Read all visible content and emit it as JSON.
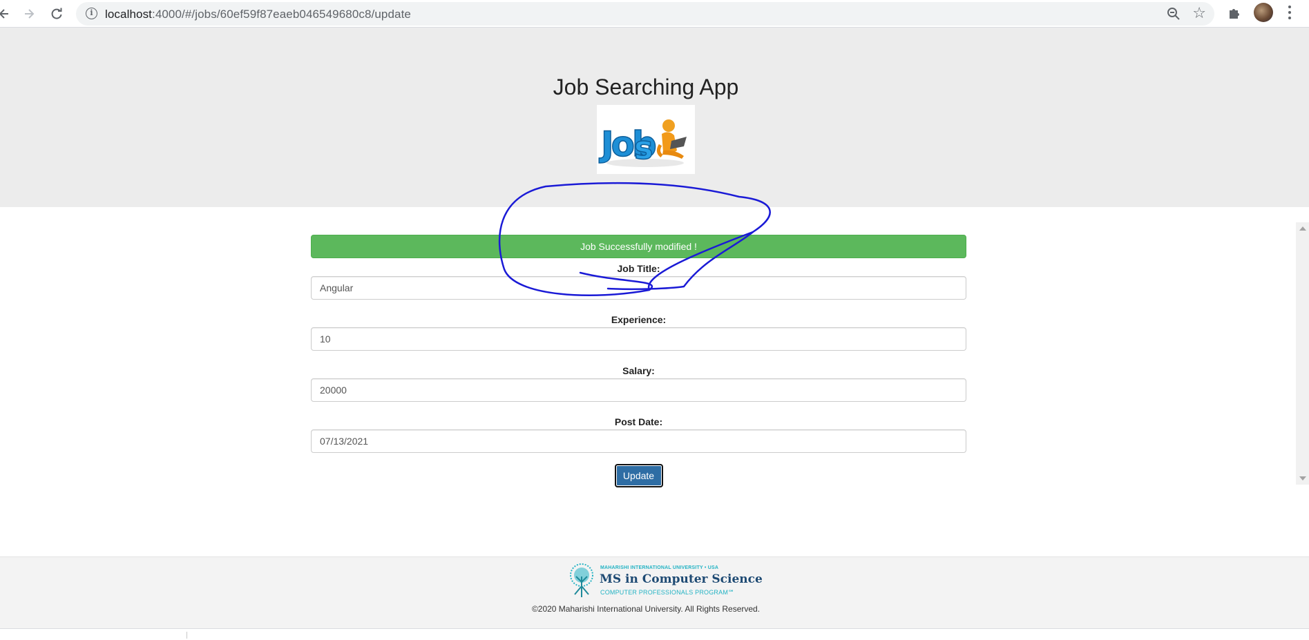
{
  "browser": {
    "url_host": "localhost",
    "url_path": ":4000/#/jobs/60ef59f87eaeb046549680c8/update",
    "back_icon": "back-arrow-icon",
    "forward_icon": "forward-arrow-icon",
    "reload_icon": "reload-icon"
  },
  "header": {
    "title": "Job Searching App",
    "logo_text": "Jobs"
  },
  "alert": {
    "message": "Job Successfully modified !",
    "color": "#5cb85c"
  },
  "form": {
    "fields": [
      {
        "label": "Job Title:",
        "value": "Angular"
      },
      {
        "label": "Experience:",
        "value": "10"
      },
      {
        "label": "Salary:",
        "value": "20000"
      },
      {
        "label": "Post Date:",
        "value": "07/13/2021"
      }
    ],
    "submit_label": "Update",
    "submit_color": "#2e6da4"
  },
  "footer": {
    "university_line": "MAHARISHI INTERNATIONAL UNIVERSITY • USA",
    "program_title": "MS in Computer Science",
    "program_subtitle": "COMPUTER PROFESSIONALS PROGRAM℠",
    "copyright": "©2020 Maharishi International University. All Rights Reserved."
  }
}
